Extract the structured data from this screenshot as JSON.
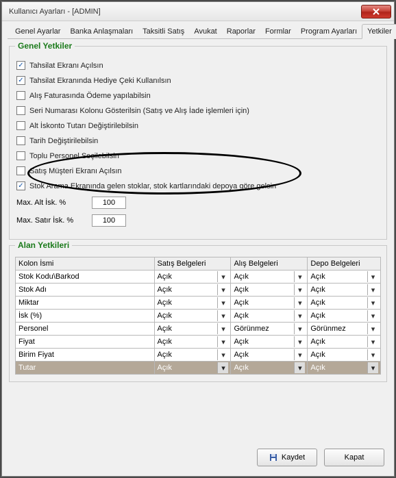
{
  "window": {
    "title": "Kullanıcı Ayarları - [ADMIN]"
  },
  "tabs": [
    "Genel Ayarlar",
    "Banka Anlaşmaları",
    "Taksitli Satış",
    "Avukat",
    "Raporlar",
    "Formlar",
    "Program Ayarları",
    "Yetkiler"
  ],
  "active_tab": 7,
  "groups": {
    "genel": "Genel Yetkiler",
    "alan": "Alan Yetkileri"
  },
  "checks": [
    {
      "label": "Tahsilat Ekranı Açılsın",
      "checked": true
    },
    {
      "label": "Tahsilat Ekranında Hediye Çeki Kullanılsın",
      "checked": true
    },
    {
      "label": "Alış Faturasında Ödeme yapılabilsin",
      "checked": false
    },
    {
      "label": "Seri Numarası Kolonu Gösterilsin (Satış ve Alış İade işlemleri için)",
      "checked": false
    },
    {
      "label": "Alt İskonto Tutarı Değiştirilebilsin",
      "checked": false
    },
    {
      "label": "Tarih Değiştirilebilsin",
      "checked": false
    },
    {
      "label": "Toplu Personel Seçilebilsin",
      "checked": false
    },
    {
      "label": "Satış Müşteri Ekranı Açılsın",
      "checked": false
    },
    {
      "label": "Stok Arama Ekranında gelen stoklar, stok kartlarındaki depoya göre gelsin",
      "checked": true
    }
  ],
  "max_alt_label": "Max. Alt İsk. %",
  "max_alt_value": "100",
  "max_satir_label": "Max. Satır İsk. %",
  "max_satir_value": "100",
  "grid": {
    "headers": [
      "Kolon İsmi",
      "Satış Belgeleri",
      "Alış Belgeleri",
      "Depo Belgeleri"
    ],
    "rows": [
      {
        "name": "Stok Kodu\\Barkod",
        "satis": "Açık",
        "alis": "Açık",
        "depo": "Açık"
      },
      {
        "name": "Stok Adı",
        "satis": "Açık",
        "alis": "Açık",
        "depo": "Açık"
      },
      {
        "name": "Miktar",
        "satis": "Açık",
        "alis": "Açık",
        "depo": "Açık"
      },
      {
        "name": "İsk (%)",
        "satis": "Açık",
        "alis": "Açık",
        "depo": "Açık"
      },
      {
        "name": "Personel",
        "satis": "Açık",
        "alis": "Görünmez",
        "depo": "Görünmez"
      },
      {
        "name": "Fiyat",
        "satis": "Açık",
        "alis": "Açık",
        "depo": "Açık"
      },
      {
        "name": "Birim Fiyat",
        "satis": "Açık",
        "alis": "Açık",
        "depo": "Açık"
      },
      {
        "name": "Tutar",
        "satis": "Açık",
        "alis": "Açık",
        "depo": "Açık",
        "selected": true
      }
    ]
  },
  "buttons": {
    "save": "Kaydet",
    "close": "Kapat"
  }
}
